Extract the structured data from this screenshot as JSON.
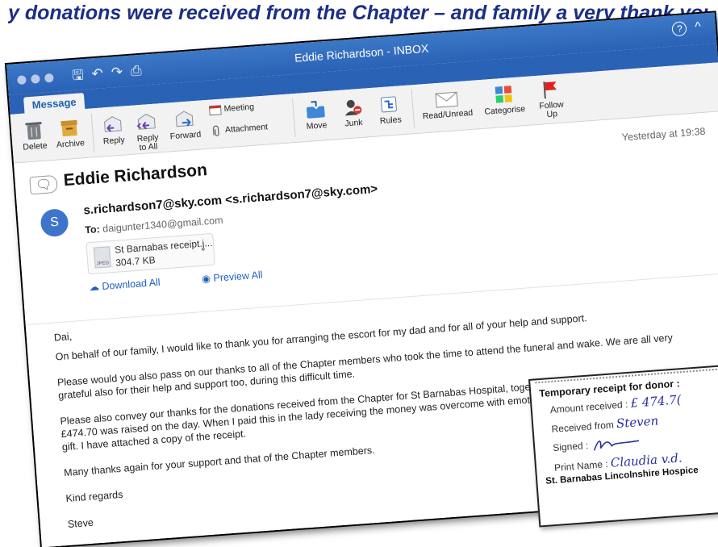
{
  "caption": "y donations were received from the Chapter – and family a very thank you from the family",
  "window": {
    "title": "Eddie Richardson - INBOX",
    "help_glyph": "?",
    "collapse_glyph": "^"
  },
  "ribbon": {
    "tab": "Message",
    "delete": "Delete",
    "archive": "Archive",
    "reply": "Reply",
    "reply_all_1": "Reply",
    "reply_all_2": "to All",
    "forward": "Forward",
    "meeting": "Meeting",
    "attachment": "Attachment",
    "move": "Move",
    "junk": "Junk",
    "rules": "Rules",
    "read_unread": "Read/Unread",
    "categorise": "Categorise",
    "follow_up_1": "Follow",
    "follow_up_2": "Up"
  },
  "email": {
    "sender_name": "Eddie Richardson",
    "date": "Yesterday at 19:38",
    "avatar_initial": "S",
    "from": "s.richardson7@sky.com <s.richardson7@sky.com>",
    "to_label": "To:",
    "to": "daigunter1340@gmail.com",
    "attachment_name": "St Barnabas receipt.j...",
    "attachment_size": "304.7 KB",
    "attachment_type": "JPEG",
    "download_all": "Download All",
    "preview_all": "Preview All"
  },
  "body": {
    "greeting": "Dai,",
    "p1": "On behalf of our family, I would like to thank you for arranging the escort for my dad and for all of your help and support.",
    "p2a": "Please would you also pass on our thanks to all of the Chapter members who took the time to attend the funeral and wake. We are all very",
    "p2b": "grateful also for their help and support too, during this difficult time.",
    "p3a": "Please also convey our thanks for the donations received from the Chapter for St Barnabas Hospital, together with family donations",
    "p3b": "£474.70 was raised on the day. When I paid this in the lady receiving the money was overcome with emotion because of such a generous",
    "p3c": "gift. I have attached a copy of the receipt.",
    "p4": "Many thanks again for your support and that of the Chapter members.",
    "closing": "Kind regards",
    "signature": "Steve"
  },
  "receipt": {
    "title": "Temporary receipt for donor :",
    "amount_label": "Amount received :",
    "amount_value": "£ 474.7(",
    "from_label": "Received from",
    "from_value": "Steven",
    "signed_label": "Signed :",
    "print_label": "Print Name :",
    "print_value": "Claudia v.d.",
    "org": "St. Barnabas Lincolnshire Hospice"
  },
  "colors": {
    "titlebar": "#2a62b5",
    "link": "#1f5fbf",
    "caption": "#1c2f86",
    "handwriting": "#2a2f9e",
    "follow_flag": "#e02020"
  }
}
